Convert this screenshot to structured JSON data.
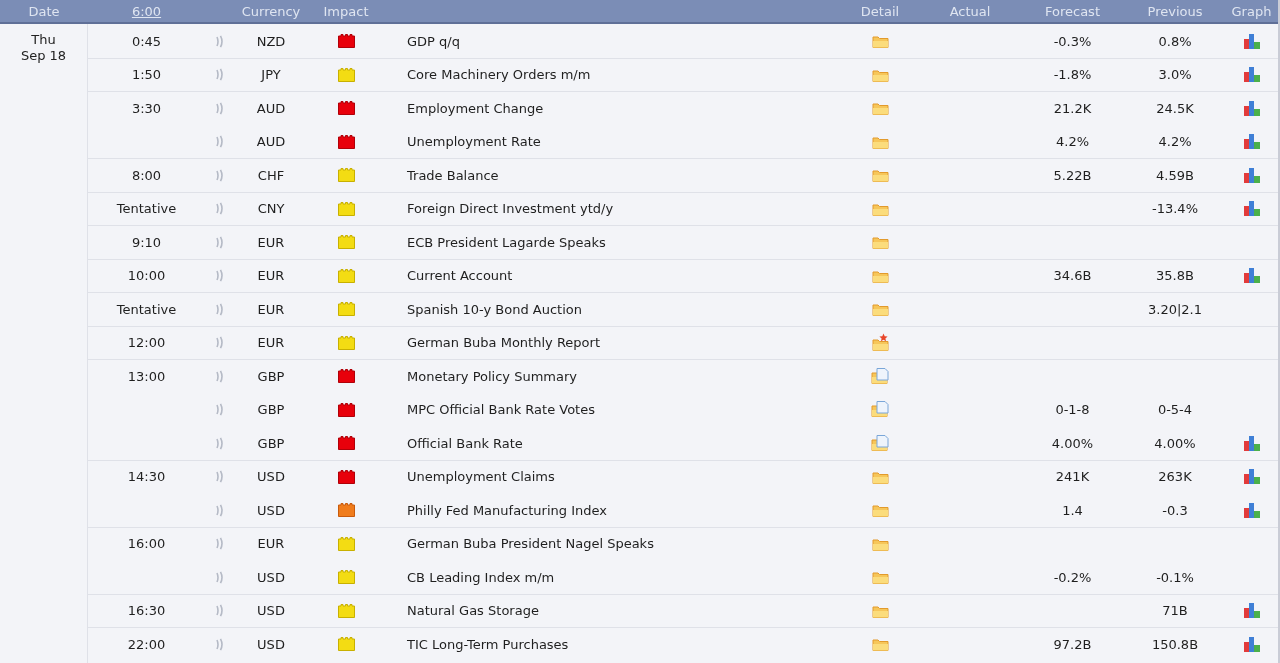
{
  "header": {
    "columns": [
      {
        "kind": "plain",
        "label": "Date"
      },
      {
        "kind": "link",
        "label": "6:00"
      },
      {
        "kind": "blank"
      },
      {
        "kind": "plain",
        "label": "Currency"
      },
      {
        "kind": "plain",
        "label": "Impact"
      },
      {
        "kind": "blank"
      },
      {
        "kind": "plain",
        "label": "Detail"
      },
      {
        "kind": "plain",
        "label": "Actual"
      },
      {
        "kind": "plain",
        "label": "Forecast"
      },
      {
        "kind": "plain",
        "label": "Previous"
      },
      {
        "kind": "plain",
        "label": "Graph"
      }
    ]
  },
  "day": {
    "weekday": "Thu",
    "date": "Sep 18"
  },
  "rows": [
    {
      "time": "0:45",
      "currency": "NZD",
      "impact": {
        "kind": "high"
      },
      "event": "GDP q/q",
      "detail": {
        "kind": "folder"
      },
      "forecast": "-0.3%",
      "previous": "0.8%",
      "graph": true
    },
    {
      "time": "1:50",
      "currency": "JPY",
      "impact": {
        "kind": "low"
      },
      "event": "Core Machinery Orders m/m",
      "detail": {
        "kind": "folder"
      },
      "forecast": "-1.8%",
      "previous": "3.0%",
      "graph": true
    },
    {
      "time": "3:30",
      "currency": "AUD",
      "impact": {
        "kind": "high"
      },
      "event": "Employment Change",
      "detail": {
        "kind": "folder"
      },
      "forecast": "21.2K",
      "previous": "24.5K",
      "graph": true
    },
    {
      "currency": "AUD",
      "impact": {
        "kind": "high"
      },
      "event": "Unemployment Rate",
      "detail": {
        "kind": "folder"
      },
      "forecast": "4.2%",
      "previous": "4.2%",
      "graph": true
    },
    {
      "time": "8:00",
      "currency": "CHF",
      "impact": {
        "kind": "low"
      },
      "event": "Trade Balance",
      "detail": {
        "kind": "folder"
      },
      "forecast": "5.22B",
      "previous": "4.59B",
      "graph": true
    },
    {
      "time": "Tentative",
      "currency": "CNY",
      "impact": {
        "kind": "low"
      },
      "event": "Foreign Direct Investment ytd/y",
      "detail": {
        "kind": "folder"
      },
      "previous": "-13.4%",
      "graph": true
    },
    {
      "time": "9:10",
      "currency": "EUR",
      "impact": {
        "kind": "low"
      },
      "event": "ECB President Lagarde Speaks",
      "detail": {
        "kind": "folder"
      },
      "graph": false
    },
    {
      "time": "10:00",
      "currency": "EUR",
      "impact": {
        "kind": "low"
      },
      "event": "Current Account",
      "detail": {
        "kind": "folder"
      },
      "forecast": "34.6B",
      "previous": "35.8B",
      "graph": true
    },
    {
      "time": "Tentative",
      "currency": "EUR",
      "impact": {
        "kind": "low"
      },
      "event": "Spanish 10-y Bond Auction",
      "detail": {
        "kind": "folder"
      },
      "previous": "3.20|2.1",
      "graph": false
    },
    {
      "time": "12:00",
      "currency": "EUR",
      "impact": {
        "kind": "low"
      },
      "event": "German Buba Monthly Report",
      "detail": {
        "kind": "folder-star"
      },
      "graph": false
    },
    {
      "time": "13:00",
      "currency": "GBP",
      "impact": {
        "kind": "high"
      },
      "event": "Monetary Policy Summary",
      "detail": {
        "kind": "folder-doc"
      },
      "graph": false
    },
    {
      "currency": "GBP",
      "impact": {
        "kind": "high"
      },
      "event": "MPC Official Bank Rate Votes",
      "detail": {
        "kind": "folder-doc"
      },
      "forecast": "0-1-8",
      "previous": "0-5-4",
      "graph": false
    },
    {
      "currency": "GBP",
      "impact": {
        "kind": "high"
      },
      "event": "Official Bank Rate",
      "detail": {
        "kind": "folder-doc"
      },
      "forecast": "4.00%",
      "previous": "4.00%",
      "graph": true
    },
    {
      "time": "14:30",
      "currency": "USD",
      "impact": {
        "kind": "high"
      },
      "event": "Unemployment Claims",
      "detail": {
        "kind": "folder"
      },
      "forecast": "241K",
      "previous": "263K",
      "graph": true
    },
    {
      "currency": "USD",
      "impact": {
        "kind": "medium"
      },
      "event": "Philly Fed Manufacturing Index",
      "detail": {
        "kind": "folder"
      },
      "forecast": "1.4",
      "previous": "-0.3",
      "graph": true
    },
    {
      "time": "16:00",
      "currency": "EUR",
      "impact": {
        "kind": "low"
      },
      "event": "German Buba President Nagel Speaks",
      "detail": {
        "kind": "folder"
      },
      "graph": false
    },
    {
      "currency": "USD",
      "impact": {
        "kind": "low"
      },
      "event": "CB Leading Index m/m",
      "detail": {
        "kind": "folder"
      },
      "forecast": "-0.2%",
      "previous": "-0.1%",
      "graph": false
    },
    {
      "time": "16:30",
      "currency": "USD",
      "impact": {
        "kind": "low"
      },
      "event": "Natural Gas Storage",
      "detail": {
        "kind": "folder"
      },
      "previous": "71B",
      "graph": true
    },
    {
      "time": "22:00",
      "currency": "USD",
      "impact": {
        "kind": "low"
      },
      "event": "TIC Long-Term Purchases",
      "detail": {
        "kind": "folder"
      },
      "forecast": "97.2B",
      "previous": "150.8B",
      "graph": true
    }
  ]
}
